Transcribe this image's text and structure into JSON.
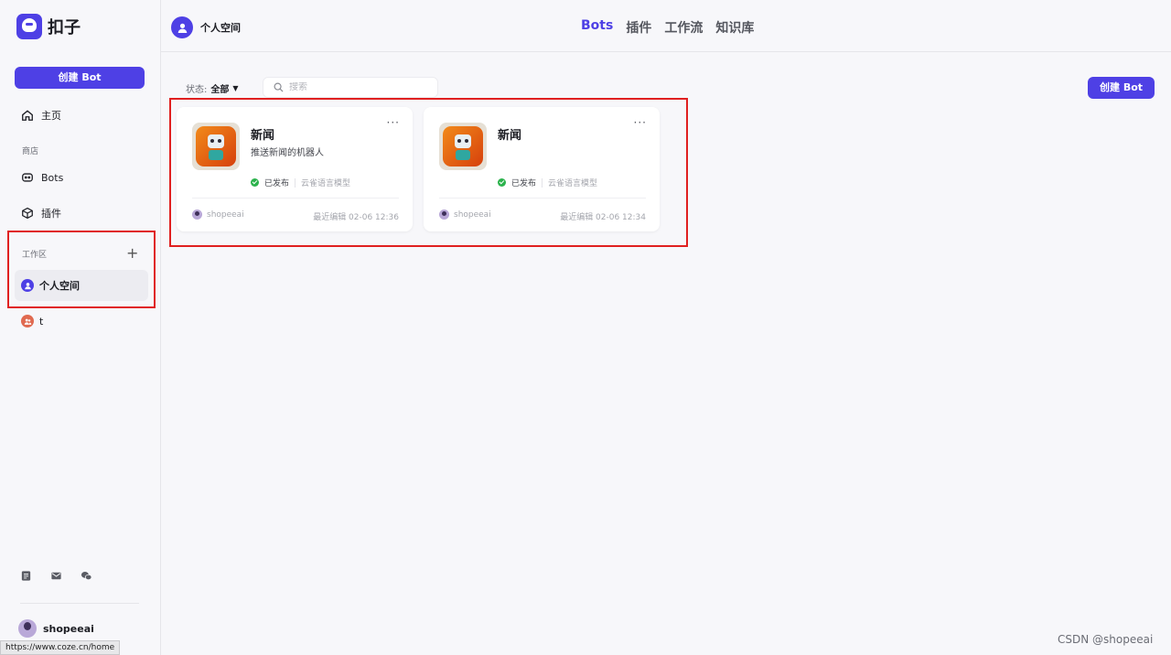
{
  "app": {
    "name": "扣子"
  },
  "sidebar": {
    "create_label": "创建 Bot",
    "home_label": "主页",
    "store_section": "商店",
    "bots_label": "Bots",
    "plugins_label": "插件",
    "workspace_section": "工作区",
    "workspaces": [
      {
        "label": "个人空间",
        "active": true,
        "color": "#4e40e5"
      },
      {
        "label": "t",
        "active": false,
        "color": "#e06a50"
      }
    ],
    "user_name": "shopeeai"
  },
  "status_bar_url": "https://www.coze.cn/home",
  "header": {
    "space_title": "个人空间",
    "tabs": [
      {
        "label": "Bots",
        "active": true
      },
      {
        "label": "插件",
        "active": false
      },
      {
        "label": "工作流",
        "active": false
      },
      {
        "label": "知识库",
        "active": false
      }
    ]
  },
  "toolbar": {
    "filter_label": "状态:",
    "filter_value": "全部",
    "search_placeholder": "搜索",
    "create_label": "创建 Bot"
  },
  "bots": [
    {
      "name": "新闻",
      "description": "推送新闻的机器人",
      "status": "已发布",
      "model": "云雀语言模型",
      "owner": "shopeeai",
      "edited": "最近编辑 02-06 12:36"
    },
    {
      "name": "新闻",
      "description": "",
      "status": "已发布",
      "model": "云雀语言模型",
      "owner": "shopeeai",
      "edited": "最近编辑 02-06 12:34"
    }
  ],
  "watermark": "CSDN @shopeeai",
  "colors": {
    "accent": "#4e40e5",
    "highlight": "#e02020",
    "published": "#2bb24c"
  }
}
